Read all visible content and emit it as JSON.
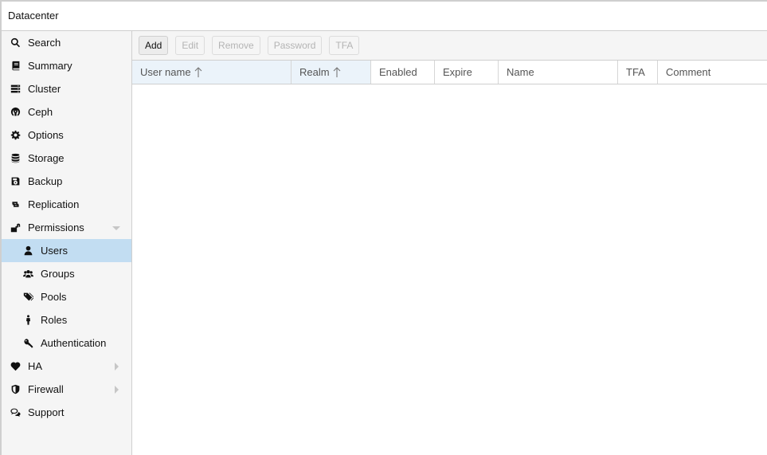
{
  "window": {
    "title": "Datacenter"
  },
  "sidebar": {
    "items": [
      {
        "label": "Search",
        "icon": "search-icon"
      },
      {
        "label": "Summary",
        "icon": "book-icon"
      },
      {
        "label": "Cluster",
        "icon": "server-icon"
      },
      {
        "label": "Ceph",
        "icon": "ceph-icon"
      },
      {
        "label": "Options",
        "icon": "gear-icon"
      },
      {
        "label": "Storage",
        "icon": "database-icon"
      },
      {
        "label": "Backup",
        "icon": "floppy-icon"
      },
      {
        "label": "Replication",
        "icon": "retweet-icon"
      },
      {
        "label": "Permissions",
        "icon": "unlock-icon",
        "expanded": true
      },
      {
        "label": "Users",
        "icon": "user-icon",
        "selected": true
      },
      {
        "label": "Groups",
        "icon": "users-icon"
      },
      {
        "label": "Pools",
        "icon": "tags-icon"
      },
      {
        "label": "Roles",
        "icon": "male-icon"
      },
      {
        "label": "Authentication",
        "icon": "key-icon"
      },
      {
        "label": "HA",
        "icon": "heartbeat-icon",
        "expanded": false
      },
      {
        "label": "Firewall",
        "icon": "shield-icon",
        "expanded": false
      },
      {
        "label": "Support",
        "icon": "comments-icon"
      }
    ]
  },
  "toolbar": {
    "add": "Add",
    "edit": "Edit",
    "remove": "Remove",
    "password": "Password",
    "tfa": "TFA"
  },
  "grid": {
    "columns": [
      {
        "label": "User name",
        "sorted": "asc"
      },
      {
        "label": "Realm",
        "sorted": "asc"
      },
      {
        "label": "Enabled"
      },
      {
        "label": "Expire"
      },
      {
        "label": "Name"
      },
      {
        "label": "TFA"
      },
      {
        "label": "Comment"
      }
    ],
    "rows": []
  },
  "colors": {
    "selected_bg": "#c2ddf2",
    "sorted_col_bg": "#ebf3fa",
    "sidebar_bg": "#f5f5f5"
  }
}
